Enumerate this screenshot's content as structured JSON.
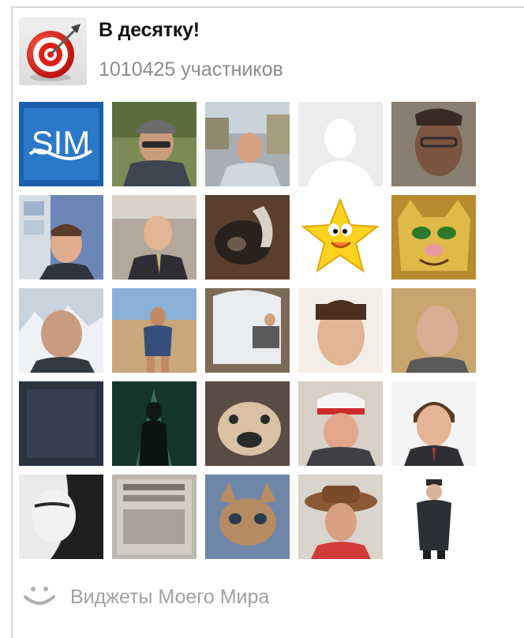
{
  "widget": {
    "title": "В десятку!",
    "members_count": "1010425 участников",
    "logo_icon": "target-dart-icon"
  },
  "members": [
    {
      "name": "member-sim-logo",
      "kind": "logo",
      "text": "SIM",
      "bg": "#1c5fae"
    },
    {
      "name": "member-man-cap-glasses",
      "kind": "photo",
      "bg": "#6f7a4a"
    },
    {
      "name": "member-man-outdoor",
      "kind": "photo",
      "bg": "#9aa0a6"
    },
    {
      "name": "member-placeholder-silhouette",
      "kind": "placeholder",
      "bg": "#e9e9e9"
    },
    {
      "name": "member-man-glasses",
      "kind": "photo",
      "bg": "#7a6c5e"
    },
    {
      "name": "member-man-office",
      "kind": "photo",
      "bg": "#5f7fae"
    },
    {
      "name": "member-man-suit-desk",
      "kind": "photo",
      "bg": "#9a8f84"
    },
    {
      "name": "member-goat",
      "kind": "photo",
      "bg": "#6a4e3a"
    },
    {
      "name": "member-cartoon-star",
      "kind": "cartoon-star",
      "bg": "#ffffff"
    },
    {
      "name": "member-cartoon-cat",
      "kind": "cartoon-cat",
      "bg": "#c9a13a"
    },
    {
      "name": "member-man-mountains",
      "kind": "photo",
      "bg": "#b9c6d4"
    },
    {
      "name": "member-man-beach",
      "kind": "photo",
      "bg": "#c7a27a"
    },
    {
      "name": "member-man-sitting-window",
      "kind": "photo",
      "bg": "#b8b1a2"
    },
    {
      "name": "member-man-portrait",
      "kind": "photo",
      "bg": "#f1ede6"
    },
    {
      "name": "member-bald-man",
      "kind": "photo",
      "bg": "#c8a56e"
    },
    {
      "name": "member-dark-blank",
      "kind": "dark",
      "bg": "#2e3542"
    },
    {
      "name": "member-dark-angel",
      "kind": "photo",
      "bg": "#1f3d36"
    },
    {
      "name": "member-bulldog",
      "kind": "photo",
      "bg": "#5a4c43"
    },
    {
      "name": "member-man-chef-hat",
      "kind": "photo",
      "bg": "#d6d0c6"
    },
    {
      "name": "member-man-suit-portrait",
      "kind": "photo",
      "bg": "#f4f4f4"
    },
    {
      "name": "member-woman-bw",
      "kind": "photo",
      "bg": "#e5e5e5"
    },
    {
      "name": "member-newspaper-collage",
      "kind": "photo",
      "bg": "#b7b2aa"
    },
    {
      "name": "member-kitten",
      "kind": "photo",
      "bg": "#6f86a8"
    },
    {
      "name": "member-man-cowboy-hat",
      "kind": "photo",
      "bg": "#d9d4cc"
    },
    {
      "name": "member-officer-figure",
      "kind": "photo",
      "bg": "#ffffff"
    }
  ],
  "footer": {
    "label": "Виджеты Моего Мира",
    "icon": "smile-icon"
  },
  "colors": {
    "border": "#d8d8d8",
    "title": "#111111",
    "muted": "#8c8c8c",
    "footer_text": "#a2a2a2"
  }
}
